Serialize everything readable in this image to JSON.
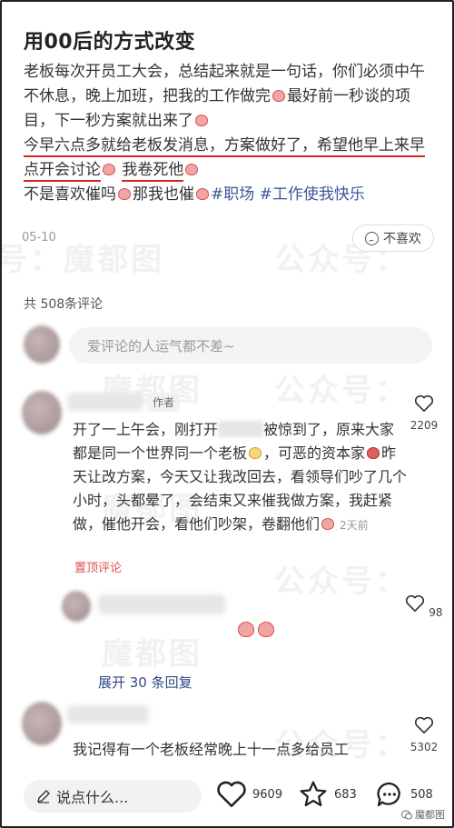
{
  "post": {
    "title": "用00后的方式改变",
    "para1": "老板每次开员工大会，总结起来就是一句话，你们必须中午不休息，晚上加班，把我的工作做完",
    "para1b": "最好前一秒谈的项目，下一秒方案就出来了",
    "highlight1": "今早六点多就给老板发消息，方案做好了，希望他早上来早点开会讨论",
    "highlight2": "我卷死他",
    "para3": "不是喜欢催吗",
    "para3b": "那我也催",
    "tag1": "#职场",
    "tag2": "#工作使我快乐",
    "date": "05-10",
    "dislike_label": "不喜欢"
  },
  "watermark": {
    "text1": "号：魔都图",
    "text2": "公众号：",
    "text3": "魔都图"
  },
  "comments": {
    "count_label": "共 508条评论",
    "input_placeholder": "爱评论的人运气都不差~",
    "author_badge": "作者",
    "c1_line1a": "开了一上午会，刚打开",
    "c1_line1b": "被惊到了，原来大家都是同一个世界同一个老板",
    "c1_line2": "，可恶的资本家",
    "c1_line3": "昨天让改方案，今天又让我改回去，看领导们吵了几个小时，头都晕了，会结束又来催我做方案，我赶紧做，催他开会，看他们吵架，卷翻他们",
    "c1_time": "2天前",
    "c1_likes": "2209",
    "pinned_label": "置顶评论",
    "c2_likes": "98",
    "expand_label": "展开 30 条回复",
    "c3_text": "我记得有一个老板经常晚上十一点多给员工",
    "c3_likes": "5302"
  },
  "bottom": {
    "say_placeholder": "说点什么...",
    "likes": "9609",
    "favorites": "683",
    "comments": "508",
    "brand": "魔都图"
  }
}
